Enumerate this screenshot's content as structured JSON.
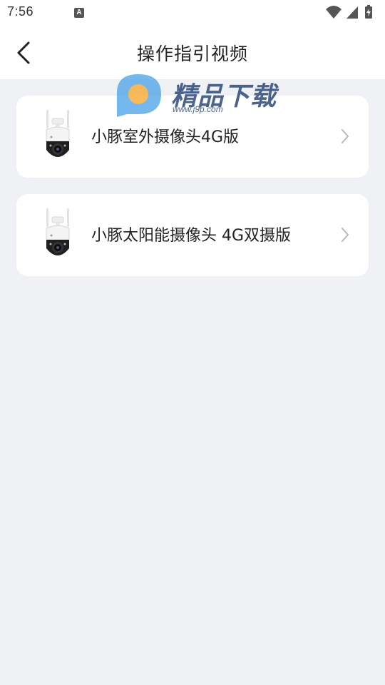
{
  "status_bar": {
    "time": "7:56",
    "notification_icon_letter": "A",
    "icons": [
      "wifi-icon",
      "signal-icon",
      "battery-charging-icon"
    ]
  },
  "header": {
    "title": "操作指引视频",
    "back_icon": "chevron-left-icon"
  },
  "items": [
    {
      "label": "小豚室外摄像头4G版",
      "image": "camera-icon",
      "chevron": "chevron-right-icon"
    },
    {
      "label": "小豚太阳能摄像头 4G双摄版",
      "image": "camera-icon",
      "chevron": "chevron-right-icon"
    }
  ],
  "watermark": {
    "text": "精品下载",
    "url": "www.j9p.com"
  },
  "colors": {
    "background": "#f0f1f5",
    "card": "#ffffff",
    "text": "#222222",
    "chevron": "#b8b8b8",
    "watermark_blue": "#4aa3e8",
    "watermark_orange": "#f6b042"
  }
}
